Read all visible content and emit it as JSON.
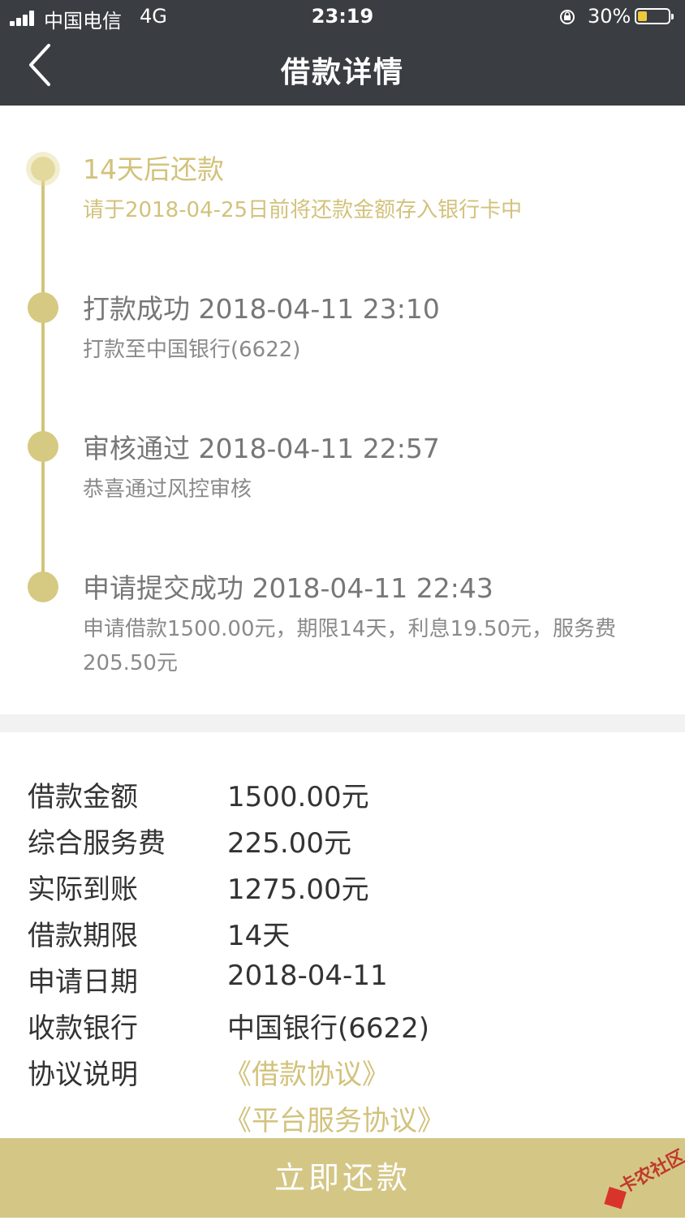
{
  "status_bar": {
    "carrier": "中国电信",
    "network": "4G",
    "time": "23:19",
    "battery_percent": "30%",
    "battery_level": 0.3
  },
  "nav": {
    "title": "借款详情",
    "back_icon": "chevron-left-icon"
  },
  "timeline": [
    {
      "title": "14天后还款",
      "desc": "请于2018-04-25日前将还款金额存入银行卡中",
      "state": "pending"
    },
    {
      "title": "打款成功 2018-04-11 23:10",
      "desc": "打款至中国银行(6622)",
      "state": "done"
    },
    {
      "title": "审核通过 2018-04-11 22:57",
      "desc": "恭喜通过风控审核",
      "state": "done"
    },
    {
      "title": "申请提交成功 2018-04-11 22:43",
      "desc": "申请借款1500.00元，期限14天，利息19.50元，服务费205.50元",
      "state": "done"
    }
  ],
  "details": [
    {
      "label": "借款金额",
      "value": "1500.00元"
    },
    {
      "label": "综合服务费",
      "value": "225.00元"
    },
    {
      "label": "实际到账",
      "value": "1275.00元"
    },
    {
      "label": "借款期限",
      "value": "14天"
    },
    {
      "label": "申请日期",
      "value": "2018-04-11"
    },
    {
      "label": "收款银行",
      "value": "中国银行(6622)"
    },
    {
      "label": "协议说明",
      "value": ""
    }
  ],
  "agreements": [
    "《借款协议》",
    "《平台服务协议》"
  ],
  "repay_button": "立即还款",
  "watermark": "卡农社区",
  "colors": {
    "nav_bg": "#3a3e43",
    "accent_gold": "#d2c27c",
    "button_bg": "#d4c786"
  }
}
